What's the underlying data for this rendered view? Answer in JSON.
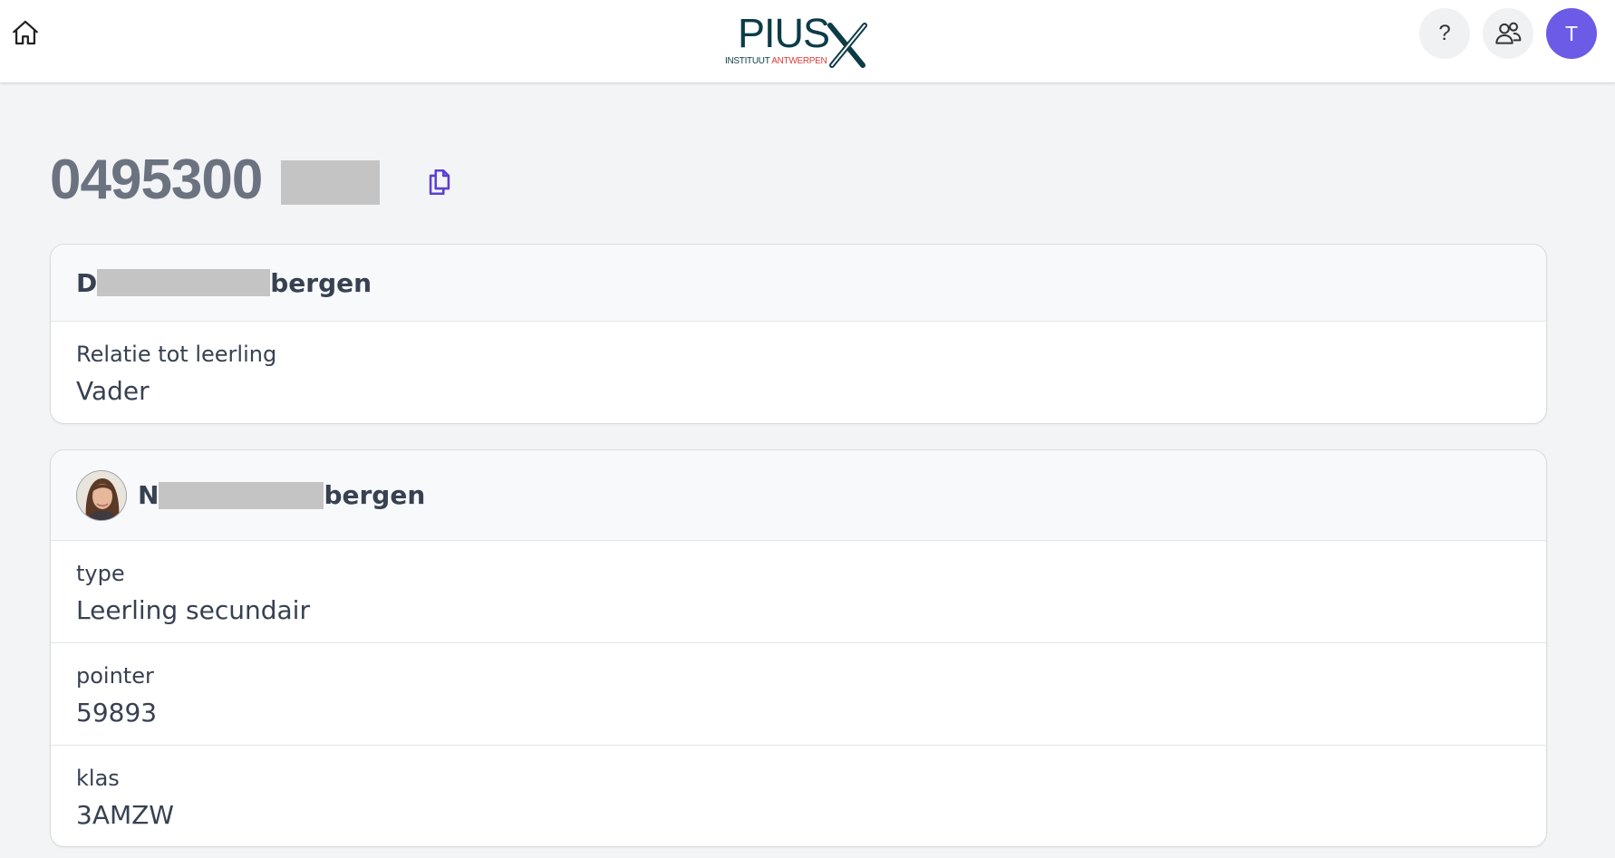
{
  "header": {
    "logo_main": "PIUS",
    "logo_sub_left": "INSTITUUT ",
    "logo_sub_right": "ANTWERPEN",
    "help_label": "?",
    "avatar_initial": "T",
    "colors": {
      "logo": "#0c3c47",
      "logo_accent": "#e03a3a",
      "avatar": "#6b5be6"
    }
  },
  "page": {
    "title_visible": "0495300",
    "copy_icon": "copy-icon"
  },
  "contact_card": {
    "name_start": "D",
    "name_end": "bergen",
    "fields": [
      {
        "label": "Relatie tot leerling",
        "value": "Vader"
      }
    ]
  },
  "student_card": {
    "name_start": "N",
    "name_end": "bergen",
    "fields": [
      {
        "label": "type",
        "value": "Leerling secundair"
      },
      {
        "label": "pointer",
        "value": "59893"
      },
      {
        "label": "klas",
        "value": "3AMZW"
      }
    ]
  }
}
